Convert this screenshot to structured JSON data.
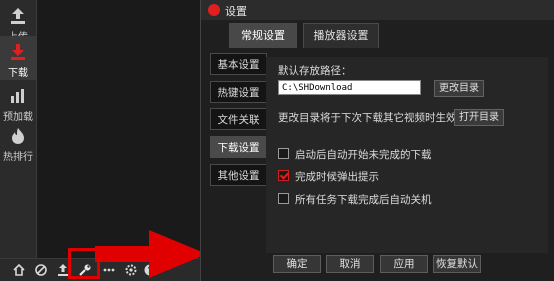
{
  "app": {
    "sidebar": {
      "items": [
        {
          "label": "上传",
          "icon": "upload-icon"
        },
        {
          "label": "下载",
          "icon": "download-icon"
        },
        {
          "label": "预加载",
          "icon": "preload-icon"
        },
        {
          "label": "热排行",
          "icon": "fire-icon"
        }
      ]
    },
    "bottom_bar": {
      "icons": [
        "home-icon",
        "ban-icon",
        "upload-icon",
        "wrench-icon",
        "dots-icon",
        "settings-icon",
        "help-icon"
      ]
    }
  },
  "dialog": {
    "title": "设置",
    "tabs": [
      "常规设置",
      "播放器设置"
    ],
    "nav": [
      "基本设置",
      "热键设置",
      "文件关联",
      "下载设置",
      "其他设置"
    ],
    "download": {
      "path_label": "默认存放路径：",
      "path_value": "C:\\SHDownload",
      "change_dir_button": "更改目录",
      "note": "更改目录将于下次下载其它视频时生效",
      "open_dir_button": "打开目录",
      "options": [
        {
          "label": "启动后自动开始未完成的下载",
          "checked": false
        },
        {
          "label": "完成时候弹出提示",
          "checked": true
        },
        {
          "label": "所有任务下载完成后自动关机",
          "checked": false
        }
      ]
    },
    "footer": {
      "ok": "确定",
      "cancel": "取消",
      "apply": "应用",
      "restore_defaults": "恢复默认"
    }
  },
  "colors": {
    "accent": "#e02020",
    "highlight": "#e00000"
  }
}
